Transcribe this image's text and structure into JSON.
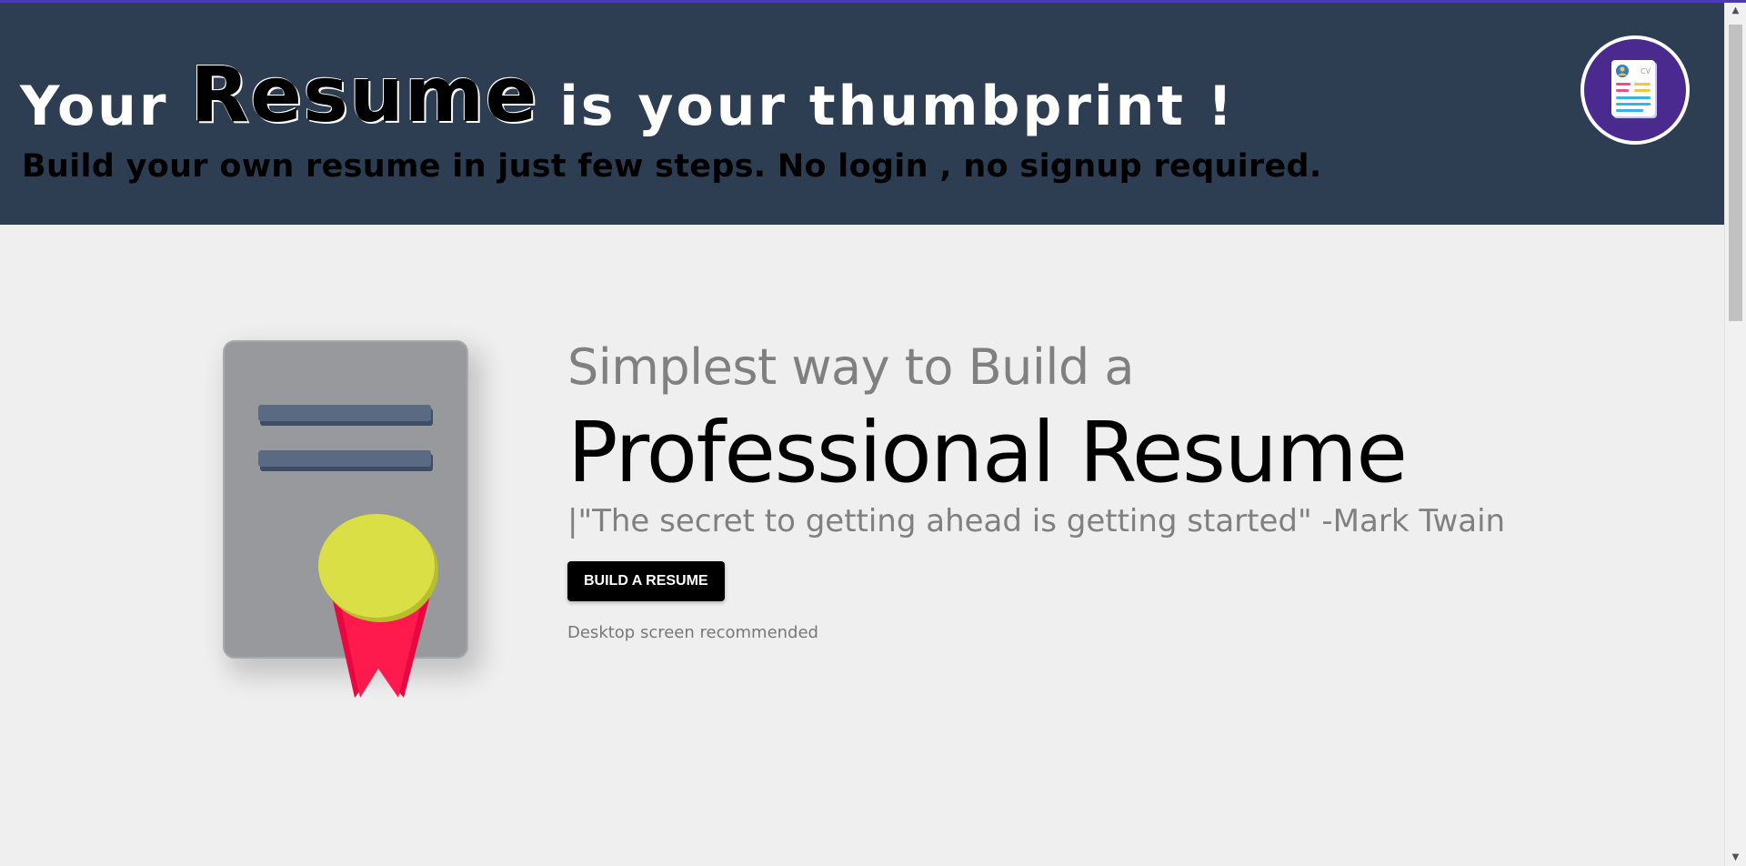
{
  "header": {
    "headline_before": "Your ",
    "headline_accent": "Resume",
    "headline_after": " is your thumbprint !",
    "subheadline": "Build your own resume in just few steps. No login , no signup required.",
    "logo_icon": "cv-document-icon",
    "background_color": "#2e3e52"
  },
  "hero": {
    "illustration_icon": "certificate-ribbon-icon",
    "tagline": "Simplest way to Build a",
    "title": "Professional Resume",
    "quote": "|\"The secret to getting ahead is getting started\" -Mark Twain",
    "button_label": "BUILD A RESUME",
    "note": "Desktop screen recommended"
  },
  "scrollbar": {
    "up_arrow": "▲",
    "down_arrow": "▼"
  }
}
